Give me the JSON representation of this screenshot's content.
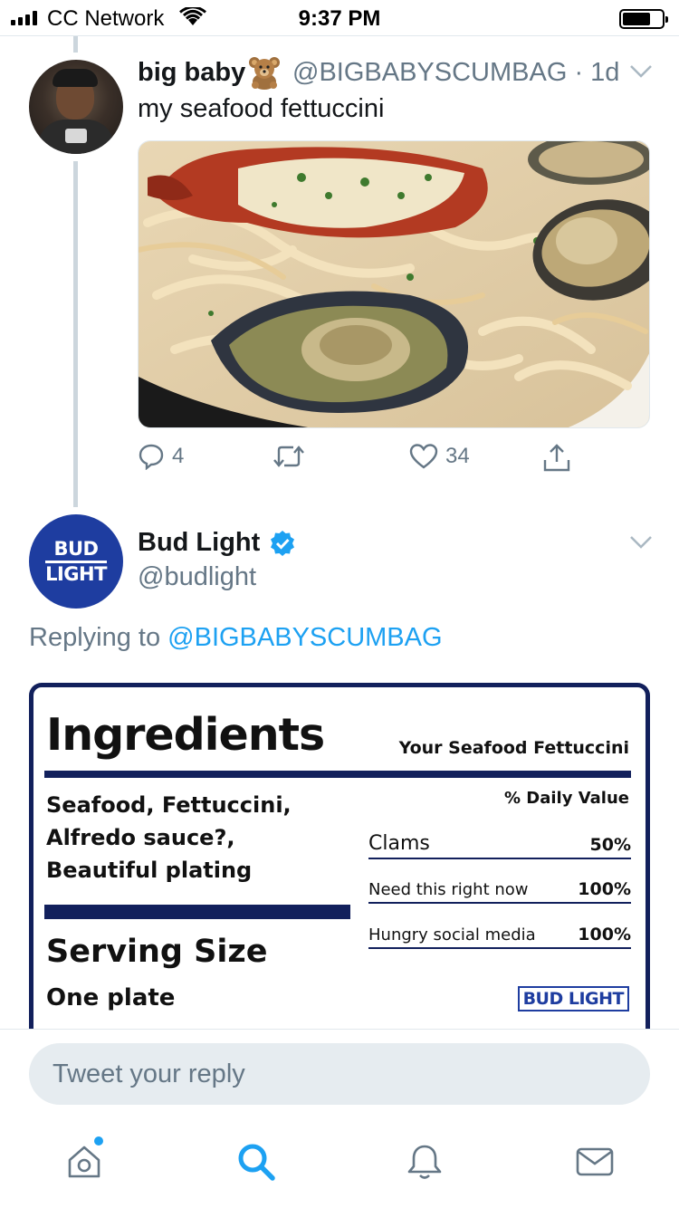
{
  "status_bar": {
    "carrier": "CC Network",
    "time": "9:37 PM"
  },
  "tweet_1": {
    "name": "big baby",
    "handle_time": "@BIGBABYSCUMBAG · 1d",
    "text": "my seafood fettuccini",
    "reply_count": "4",
    "like_count": "34"
  },
  "tweet_2": {
    "name": "Bud Light",
    "handle": "@budlight",
    "replying_prefix": "Replying to ",
    "replying_mention": "@BIGBABYSCUMBAG",
    "avatar_logo": {
      "line1": "BUD",
      "line2": "LIGHT"
    }
  },
  "ingredients_card": {
    "title": "Ingredients",
    "subtitle": "Your Seafood Fettuccini",
    "ingredients": [
      "Seafood, Fettuccini,",
      "Alfredo sauce?,",
      "Beautiful plating"
    ],
    "serving_title": "Serving Size",
    "serving_value": "One plate",
    "daily_value_header": "% Daily Value",
    "rows": [
      {
        "label": "Clams",
        "value": "50%"
      },
      {
        "label": "Need this right now",
        "value": "100%"
      },
      {
        "label": "Hungry social media",
        "value": "100%"
      }
    ],
    "badge": "BUD LIGHT"
  },
  "reply_bar": {
    "placeholder": "Tweet your reply"
  },
  "colors": {
    "accent": "#1da1f2",
    "muted": "#657786",
    "bud_blue": "#1e3da0",
    "navy": "#12205c"
  },
  "icons": {
    "reply": "speech-bubble-icon",
    "retweet": "retweet-icon",
    "like": "heart-icon",
    "share": "share-icon",
    "home": "home-icon",
    "search": "search-icon",
    "notifications": "bell-icon",
    "messages": "envelope-icon"
  }
}
